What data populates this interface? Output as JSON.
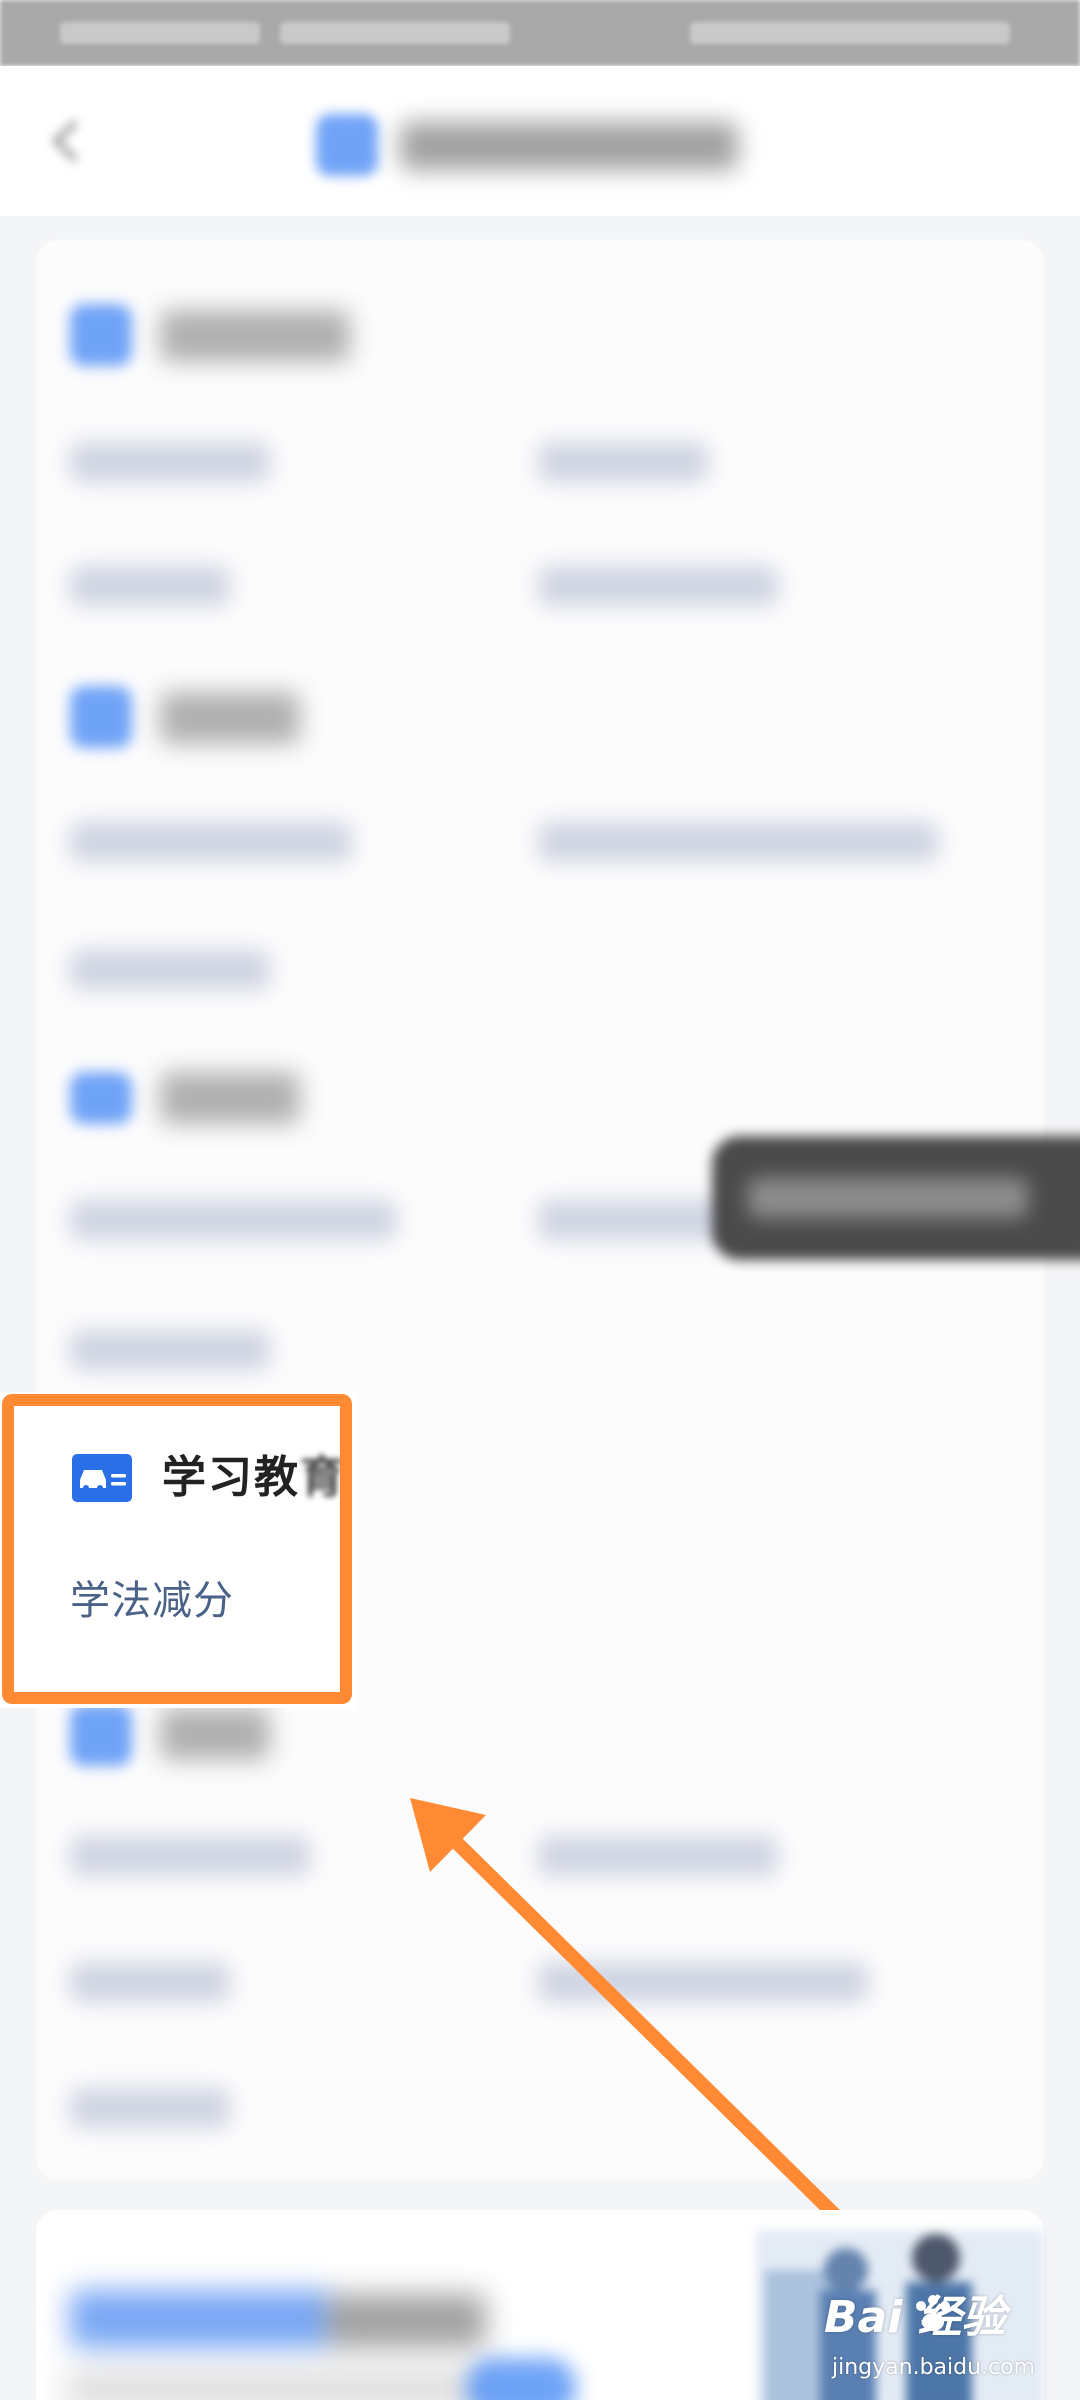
{
  "focused_section": {
    "title_visible": "学习教",
    "title_faded": "育",
    "items": [
      {
        "label": "学法减分"
      }
    ]
  },
  "annotation": {
    "box_color": "#ff8a33",
    "arrow_color": "#ff8a33"
  },
  "watermark": {
    "logo_text": "Bai  经验",
    "url": "jingyan.baidu.com"
  },
  "colors": {
    "accent": "#4d8df5",
    "link_text": "#4a6288",
    "page_bg": "#f4f5f7"
  },
  "icons": {
    "back": "back-arrow-icon",
    "service_center": "app-icon",
    "vehicle_license": "car-card-icon",
    "floating_action": "edit-icon",
    "baidu_paw": "paw-icon"
  }
}
